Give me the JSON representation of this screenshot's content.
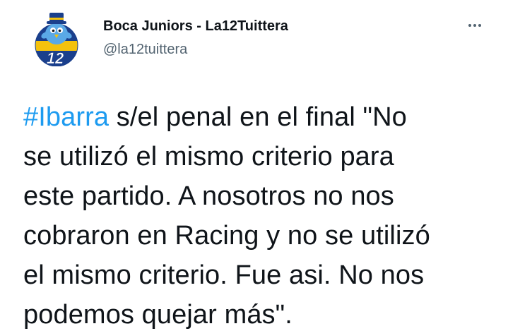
{
  "tweet": {
    "author": {
      "display_name": "Boca Juniors - La12Tuittera",
      "handle": "@la12tuittera",
      "avatar_icon": "la12-bird-mascot-logo",
      "avatar_badge_text": "12"
    },
    "more_icon": "more-horizontal-icon",
    "text": {
      "line1_hashtag": "#Ibarra",
      "line1_rest": " s/el penal en el final \"No",
      "line2": "se utilizó el mismo criterio para",
      "line3": "este partido. A nosotros no nos",
      "line4": "cobraron en Racing y no se utilizó",
      "line5": "el mismo criterio. Fue asi. No nos",
      "line6": "podemos quejar más\"."
    }
  },
  "colors": {
    "hashtag": "#1d9bf0",
    "text": "#0f1419",
    "secondary": "#536471",
    "boca_blue": "#1a3f8c",
    "boca_yellow": "#f4c20d",
    "bird_blue": "#5aa9e6"
  }
}
